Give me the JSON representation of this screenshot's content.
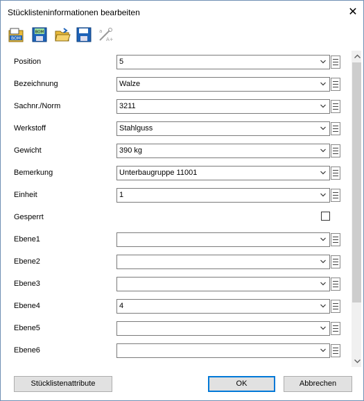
{
  "window": {
    "title": "Stücklisteninformationen bearbeiten",
    "close_glyph": "✕"
  },
  "toolbar": {
    "icons": [
      "bom-open-icon",
      "bom-save-icon",
      "folder-open-icon",
      "save-floppy-icon",
      "attribute-wizard-icon"
    ],
    "bom_text": "BOM"
  },
  "fields": [
    {
      "label": "Position",
      "value": "5",
      "type": "combo"
    },
    {
      "label": "Bezeichnung",
      "value": "Walze",
      "type": "combo"
    },
    {
      "label": "Sachnr./Norm",
      "value": "3211",
      "type": "combo"
    },
    {
      "label": "Werkstoff",
      "value": "Stahlguss",
      "type": "combo"
    },
    {
      "label": "Gewicht",
      "value": "390 kg",
      "type": "combo"
    },
    {
      "label": "Bemerkung",
      "value": "Unterbaugruppe 11001",
      "type": "combo"
    },
    {
      "label": "Einheit",
      "value": "1",
      "type": "combo"
    },
    {
      "label": "Gesperrt",
      "value": "",
      "type": "checkbox",
      "checked": false
    },
    {
      "label": "Ebene1",
      "value": "",
      "type": "combo"
    },
    {
      "label": "Ebene2",
      "value": "",
      "type": "combo"
    },
    {
      "label": "Ebene3",
      "value": "",
      "type": "combo"
    },
    {
      "label": "Ebene4",
      "value": "4",
      "type": "combo"
    },
    {
      "label": "Ebene5",
      "value": "",
      "type": "combo"
    },
    {
      "label": "Ebene6",
      "value": "",
      "type": "combo"
    }
  ],
  "buttons": {
    "attributes": "Stücklistenattribute",
    "ok": "OK",
    "cancel": "Abbrechen"
  },
  "colors": {
    "accent": "#0078d7",
    "folder": "#e8b93a",
    "floppy": "#1e63b8"
  }
}
